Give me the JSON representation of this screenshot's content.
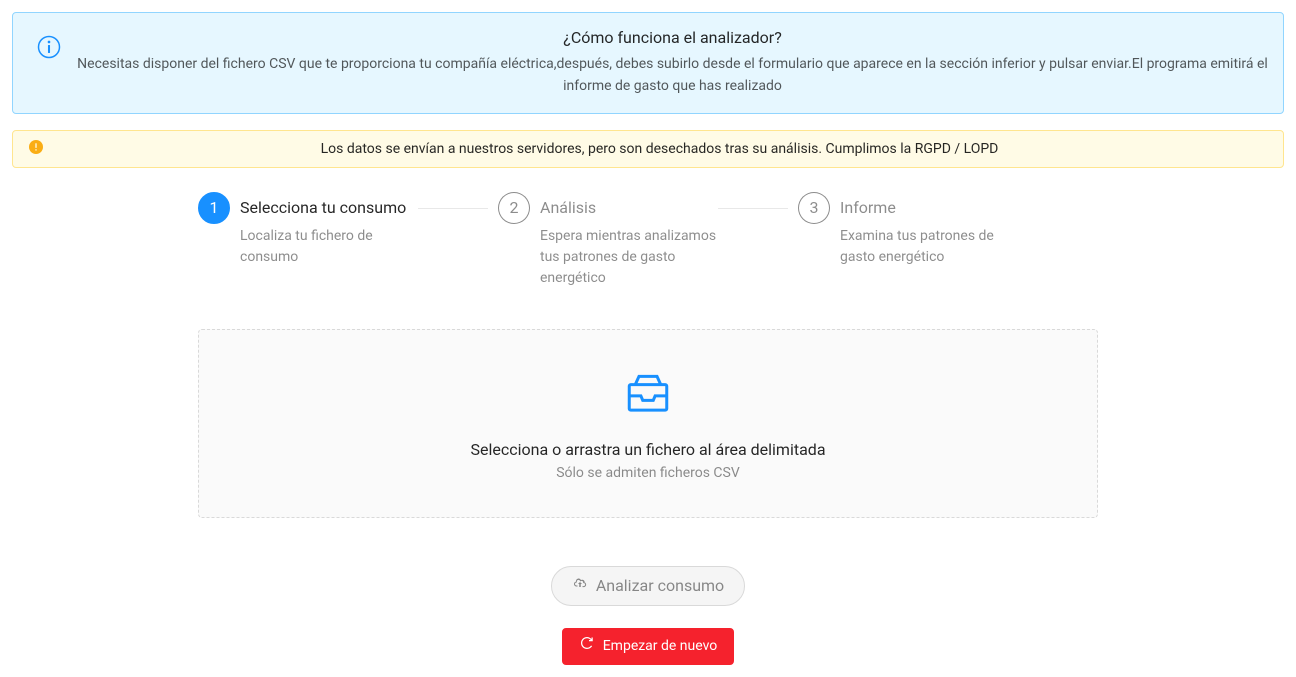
{
  "info_alert": {
    "title": "¿Cómo funciona el analizador?",
    "description": "Necesitas disponer del fichero CSV que te proporciona tu compañía eléctrica,después, debes subirlo desde el formulario que aparece en la sección inferior y pulsar enviar.El programa emitirá el informe de gasto que has realizado"
  },
  "warning_alert": {
    "text": "Los datos se envían a nuestros servidores, pero son desechados tras su análisis. Cumplimos la RGPD / LOPD"
  },
  "steps": [
    {
      "num": "1",
      "title": "Selecciona tu consumo",
      "desc": "Localiza tu fichero de consumo"
    },
    {
      "num": "2",
      "title": "Análisis",
      "desc": "Espera mientras analizamos tus patrones de gasto energético"
    },
    {
      "num": "3",
      "title": "Informe",
      "desc": "Examina tus patrones de gasto energético"
    }
  ],
  "upload": {
    "title": "Selecciona o arrastra un fichero al área delimitada",
    "hint": "Sólo se admiten ficheros CSV"
  },
  "buttons": {
    "analyze": "Analizar consumo",
    "restart": "Empezar de nuevo"
  }
}
